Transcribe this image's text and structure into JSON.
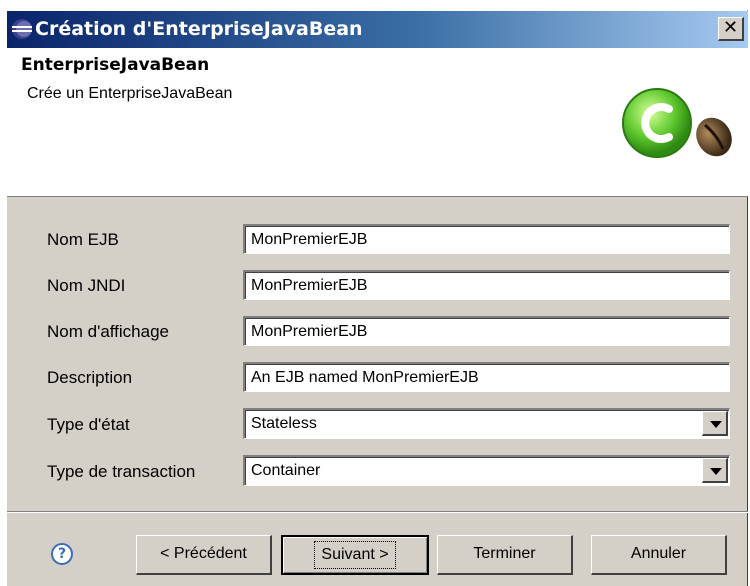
{
  "window": {
    "title": "Création d'EnterpriseJavaBean",
    "close_label": "✕"
  },
  "banner": {
    "title": "EnterpriseJavaBean",
    "description": "Crée un EnterpriseJavaBean",
    "icon": "ejb-wizard-icon"
  },
  "form": {
    "fields": [
      {
        "label": "Nom EJB",
        "value": "MonPremierEJB"
      },
      {
        "label": "Nom JNDI",
        "value": "MonPremierEJB"
      },
      {
        "label": "Nom d'affichage",
        "value": "MonPremierEJB"
      },
      {
        "label": "Description",
        "value": "An EJB named MonPremierEJB"
      }
    ],
    "combos": [
      {
        "label": "Type d'état",
        "value": "Stateless"
      },
      {
        "label": "Type de transaction",
        "value": "Container"
      }
    ]
  },
  "buttons": {
    "help": "?",
    "back": "< Précédent",
    "next": "Suivant >",
    "finish": "Terminer",
    "cancel": "Annuler"
  },
  "colors": {
    "titlebar_start": "#0a246a",
    "titlebar_end": "#a6caf0",
    "dialog_face": "#d4d0c8"
  }
}
